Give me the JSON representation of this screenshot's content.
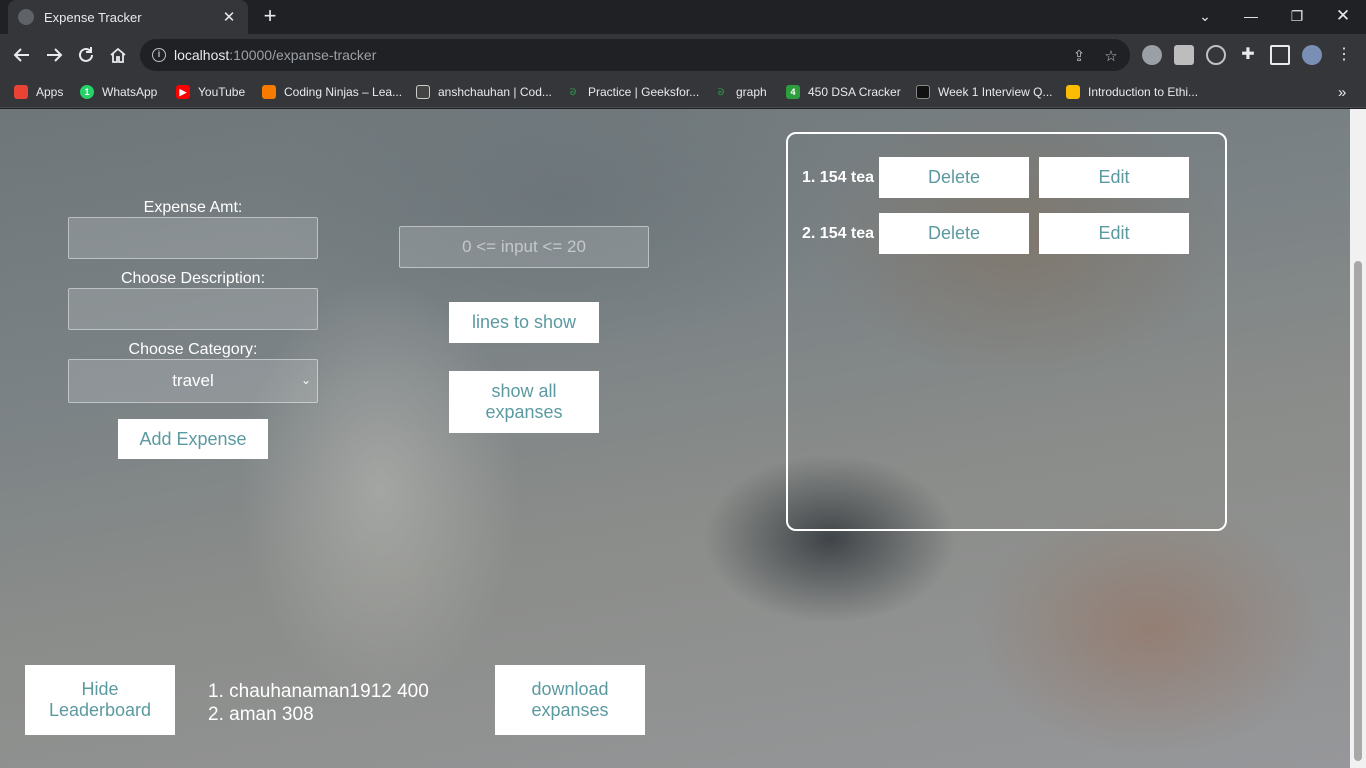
{
  "browser": {
    "tab_title": "Expense Tracker",
    "url_host": "localhost",
    "url_path": ":10000/expanse-tracker",
    "bookmarks": [
      {
        "label": "Apps",
        "color": "#ea4335"
      },
      {
        "label": "WhatsApp",
        "color": "#25d366"
      },
      {
        "label": "YouTube",
        "color": "#ff0000"
      },
      {
        "label": "Coding Ninjas – Lea...",
        "color": "#f77b00"
      },
      {
        "label": "anshchauhan | Cod...",
        "color": "#444444"
      },
      {
        "label": "Practice | Geeksfor...",
        "color": "#2f8d46"
      },
      {
        "label": "graph",
        "color": "#2f8d46"
      },
      {
        "label": "450 DSA Cracker",
        "color": "#2e9d3e"
      },
      {
        "label": "Week 1 Interview Q...",
        "color": "#111111"
      },
      {
        "label": "Introduction to Ethi...",
        "color": "#fbbc04"
      }
    ],
    "whatsapp_badge": "1",
    "dsa_badge": "4",
    "bookmarks_more": "»"
  },
  "form": {
    "amount_label": "Expense Amt:",
    "amount_value": "",
    "description_label": "Choose Description:",
    "description_value": "",
    "category_label": "Choose Category:",
    "category_selected": "travel",
    "add_button": "Add Expense"
  },
  "controls": {
    "lines_placeholder": "0 <= input <= 20",
    "lines_button": "lines to show",
    "show_all_button": "show all expanses"
  },
  "expenses": [
    {
      "text": "1. 154 tea",
      "delete": "Delete",
      "edit": "Edit"
    },
    {
      "text": "2. 154 tea",
      "delete": "Delete",
      "edit": "Edit"
    }
  ],
  "leaderboard": {
    "toggle_button": "Hide Leaderboard",
    "entries": [
      "1. chauhanaman1912 400",
      "2. aman 308"
    ]
  },
  "download_button": "download expanses",
  "colors": {
    "button_text": "#5b9aa0",
    "button_bg": "#ffffff",
    "chrome_dark": "#202124",
    "chrome_toolbar": "#35363a"
  }
}
